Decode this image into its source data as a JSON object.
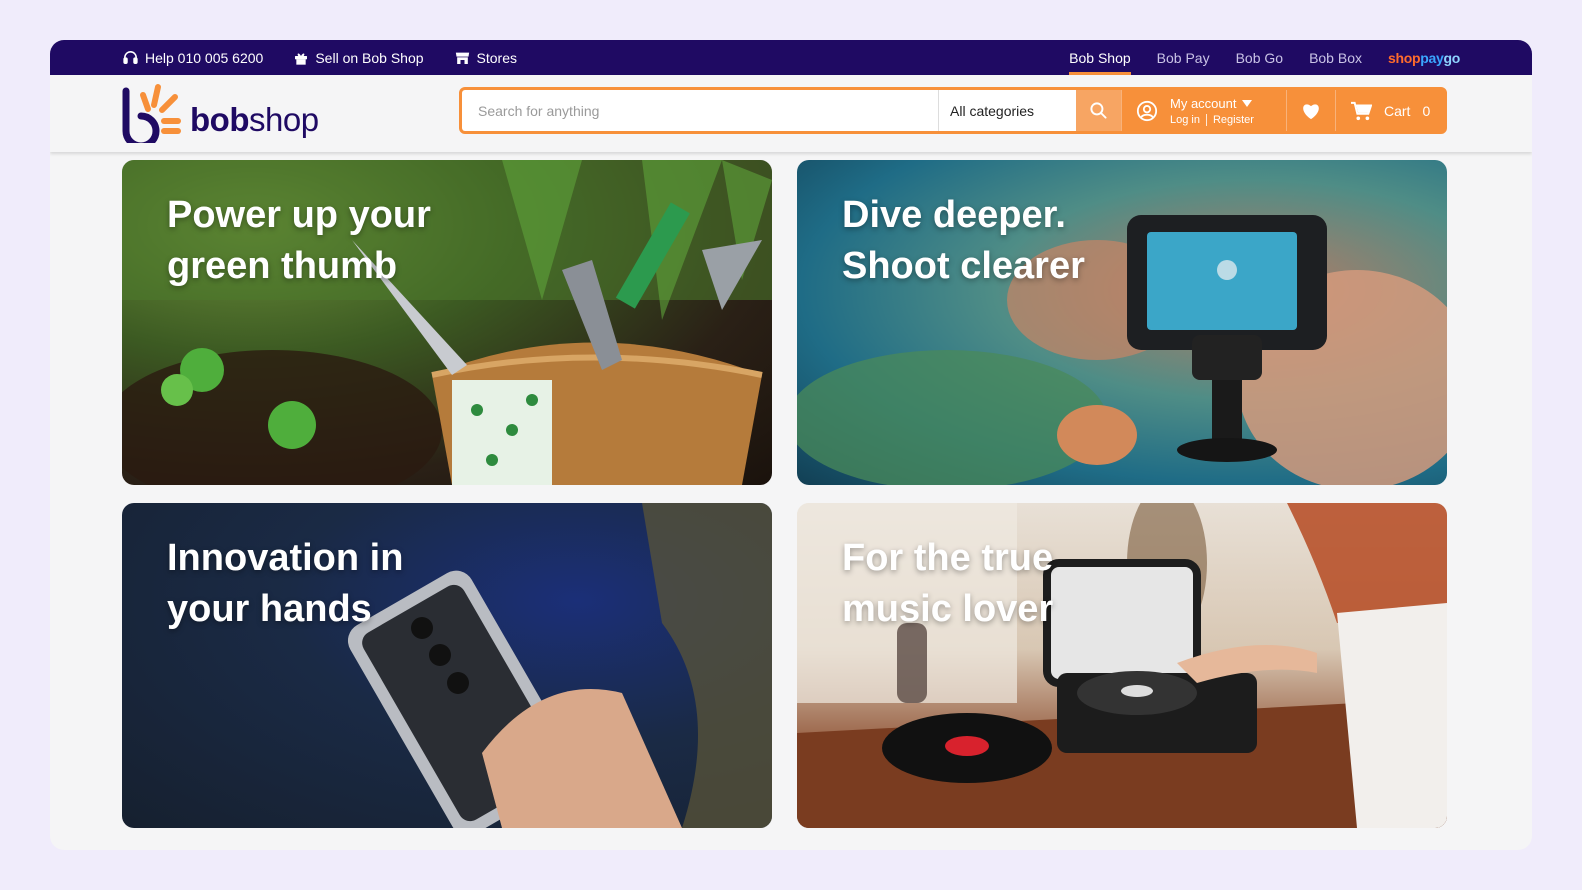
{
  "topbar": {
    "help": "Help 010 005 6200",
    "sell": "Sell on Bob Shop",
    "stores": "Stores",
    "nav": [
      "Bob Shop",
      "Bob Pay",
      "Bob Go",
      "Bob Box"
    ],
    "active": "Bob Shop",
    "shopaygo": {
      "shop": "shop",
      "pay": "pay",
      "go": "go"
    }
  },
  "logo": {
    "bold": "bob",
    "light": "shop"
  },
  "search": {
    "placeholder": "Search for anything",
    "category": "All categories"
  },
  "account": {
    "label": "My account",
    "login": "Log in",
    "register": "Register"
  },
  "cart": {
    "label": "Cart",
    "count": "0"
  },
  "banners": [
    {
      "title": "Power up your\ngreen thumb",
      "icon": "gardening-image"
    },
    {
      "title": "Dive deeper.\nShoot clearer",
      "icon": "underwater-camera-image"
    },
    {
      "title": "Innovation in\nyour hands",
      "icon": "smartphone-image"
    },
    {
      "title": "For the true\nmusic lover",
      "icon": "turntable-image"
    }
  ],
  "colors": {
    "brand_navy": "#1f0a63",
    "accent_orange": "#f7903a",
    "page_bg": "#f0ecfb"
  }
}
